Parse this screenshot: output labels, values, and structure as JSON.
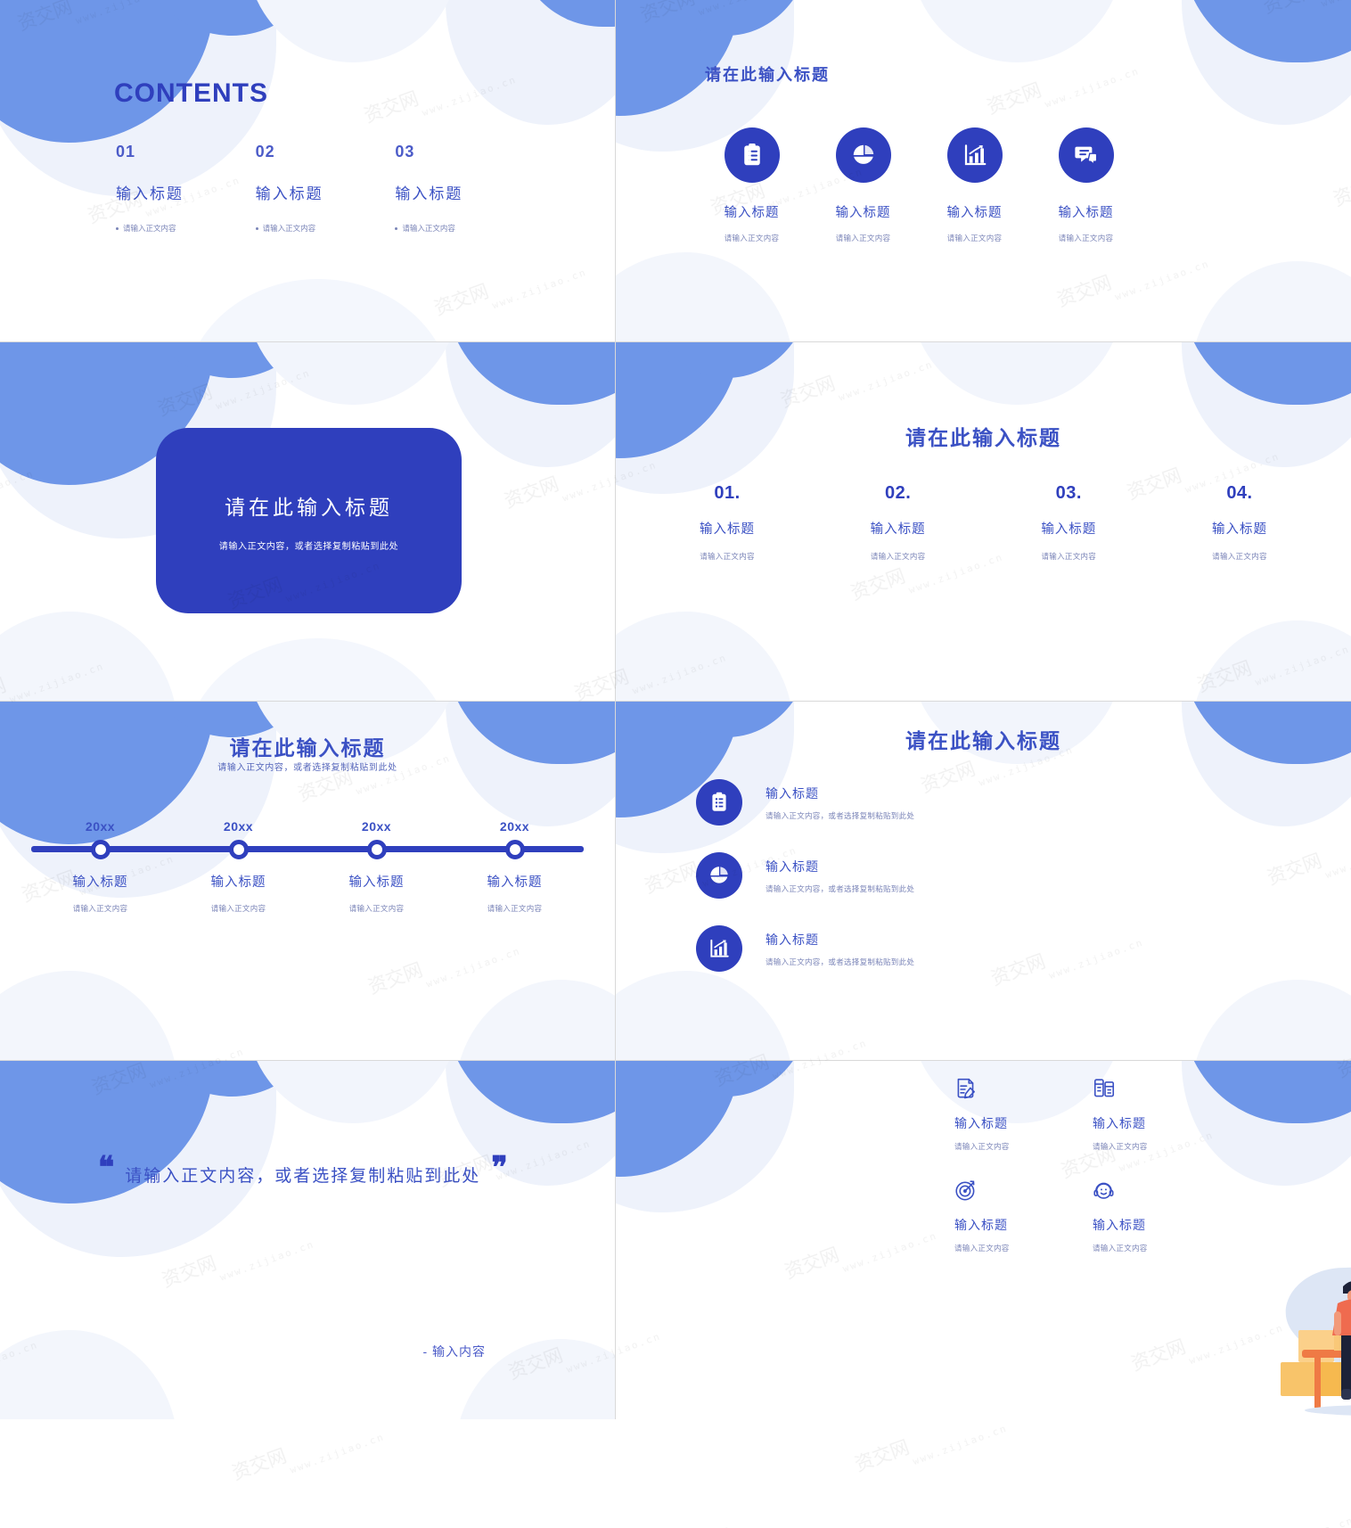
{
  "theme": {
    "primary": "#2f3fbd",
    "primary_light": "#6e96e8",
    "text_blue": "#3b51c4",
    "muted": "#7b85b8",
    "pale_blob": "#eef2fb"
  },
  "watermark": {
    "cn": "资交网",
    "url": "www.zijiao.cn"
  },
  "slides": [
    {
      "id": "contents",
      "title": "CONTENTS",
      "items": [
        {
          "num": "01",
          "title": "输入标题",
          "bullet": "请输入正文内容"
        },
        {
          "num": "02",
          "title": "输入标题",
          "bullet": "请输入正文内容"
        },
        {
          "num": "03",
          "title": "输入标题",
          "bullet": "请输入正文内容"
        }
      ]
    },
    {
      "id": "four-icons",
      "title": "请在此输入标题",
      "items": [
        {
          "icon": "clipboard-list-icon",
          "title": "输入标题",
          "sub": "请输入正文内容"
        },
        {
          "icon": "pie-chart-icon",
          "title": "输入标题",
          "sub": "请输入正文内容"
        },
        {
          "icon": "bar-chart-icon",
          "title": "输入标题",
          "sub": "请输入正文内容"
        },
        {
          "icon": "chat-bubble-icon",
          "title": "输入标题",
          "sub": "请输入正文内容"
        }
      ]
    },
    {
      "id": "section-card",
      "title": "请在此输入标题",
      "sub": "请输入正文内容，或者选择复制粘贴到此处"
    },
    {
      "id": "numbered-four",
      "title": "请在此输入标题",
      "items": [
        {
          "num": "01.",
          "title": "输入标题",
          "sub": "请输入正文内容"
        },
        {
          "num": "02.",
          "title": "输入标题",
          "sub": "请输入正文内容"
        },
        {
          "num": "03.",
          "title": "输入标题",
          "sub": "请输入正文内容"
        },
        {
          "num": "04.",
          "title": "输入标题",
          "sub": "请输入正文内容"
        }
      ]
    },
    {
      "id": "timeline",
      "title": "请在此输入标题",
      "sub": "请输入正文内容，或者选择复制粘贴到此处",
      "items": [
        {
          "year": "20xx",
          "title": "输入标题",
          "sub": "请输入正文内容"
        },
        {
          "year": "20xx",
          "title": "输入标题",
          "sub": "请输入正文内容"
        },
        {
          "year": "20xx",
          "title": "输入标题",
          "sub": "请输入正文内容"
        },
        {
          "year": "20xx",
          "title": "输入标题",
          "sub": "请输入正文内容"
        }
      ]
    },
    {
      "id": "icon-list",
      "title": "请在此输入标题",
      "items": [
        {
          "icon": "clipboard-list-icon",
          "title": "输入标题",
          "sub": "请输入正文内容，或者选择复制粘贴到此处"
        },
        {
          "icon": "pie-chart-icon",
          "title": "输入标题",
          "sub": "请输入正文内容，或者选择复制粘贴到此处"
        },
        {
          "icon": "bar-chart-icon",
          "title": "输入标题",
          "sub": "请输入正文内容，或者选择复制粘贴到此处"
        }
      ]
    },
    {
      "id": "quote",
      "open_quote": "❝",
      "close_quote": "❞",
      "text": "请输入正文内容，或者选择复制粘贴到此处",
      "attribution": "- 输入内容"
    },
    {
      "id": "illustration-four",
      "illustration": "market-stall-people-illustration",
      "items": [
        {
          "icon": "document-edit-icon",
          "title": "输入标题",
          "sub": "请输入正文内容"
        },
        {
          "icon": "device-compare-icon",
          "title": "输入标题",
          "sub": "请输入正文内容"
        },
        {
          "icon": "target-icon",
          "title": "输入标题",
          "sub": "请输入正文内容"
        },
        {
          "icon": "headset-support-icon",
          "title": "输入标题",
          "sub": "请输入正文内容"
        }
      ]
    }
  ]
}
